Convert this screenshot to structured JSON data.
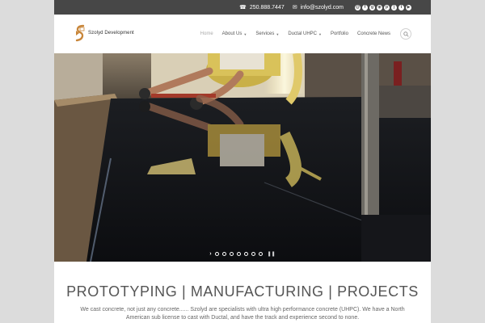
{
  "topbar": {
    "phone": "250.888.7447",
    "email": "info@szolyd.com",
    "social_icons": [
      "email-icon",
      "facebook-icon",
      "google-plus-icon",
      "instagram-icon",
      "pinterest-icon",
      "rss-icon",
      "twitter-icon",
      "youtube-icon"
    ]
  },
  "header": {
    "logo_text": "Szolyd Development",
    "nav": [
      {
        "label": "Home",
        "active": true,
        "dropdown": false
      },
      {
        "label": "About Us",
        "active": false,
        "dropdown": true
      },
      {
        "label": "Services",
        "active": false,
        "dropdown": true
      },
      {
        "label": "Ductal UHPC",
        "active": false,
        "dropdown": true
      },
      {
        "label": "Portfolio",
        "active": false,
        "dropdown": false
      },
      {
        "label": "Concrete News",
        "active": false,
        "dropdown": false
      }
    ]
  },
  "slider": {
    "slide_count": 7,
    "active_slide": 1
  },
  "main": {
    "headline": "PROTOTYPING | MANUFACTURING | PROJECTS",
    "intro": "We cast concrete, not just any concrete...... Szolyd are specialists with ultra high performance concrete (UHPC). We have a North American sub license to cast with Ductal, and have the track and experience second to none."
  },
  "colors": {
    "topbar_bg": "#474747",
    "page_bg": "#dcdcdc",
    "accent": "#c8863a"
  }
}
